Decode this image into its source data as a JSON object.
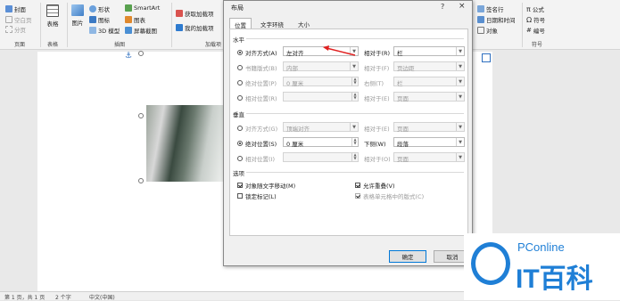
{
  "ribbon": {
    "left_items": [
      "封面",
      "空白页",
      "分页"
    ],
    "table_label": "表格",
    "illustrations": {
      "picture": "图片",
      "shapes": "形状",
      "icons": "图标",
      "model3d": "3D 模型",
      "smartart": "SmartArt",
      "chart": "图表",
      "screenshot": "屏幕截图"
    },
    "addins": {
      "get": "获取加载项",
      "my": "我的加载项"
    },
    "right_items": {
      "signature": "签名行",
      "datetime": "日期和时间",
      "object": "对象",
      "equation": "公式",
      "symbol": "符号",
      "number": "编号"
    },
    "group_labels": {
      "pages": "页面",
      "tables": "表格",
      "illustrations": "插图",
      "addins": "加载项",
      "symbols": "符号"
    }
  },
  "dialog": {
    "title": "布局",
    "help": "?",
    "close": "×",
    "tabs": [
      "位置",
      "文字环绕",
      "大小"
    ],
    "horizontal": {
      "heading": "水平",
      "rows": [
        {
          "label": "对齐方式(A)",
          "value": "左对齐",
          "rel_label": "相对于(R)",
          "rel_value": "栏",
          "enabled": true,
          "selected": true
        },
        {
          "label": "书籍版式(B)",
          "value": "内部",
          "rel_label": "相对于(F)",
          "rel_value": "页边距",
          "enabled": false,
          "selected": false
        },
        {
          "label": "绝对位置(P)",
          "value": "0 厘米",
          "rel_label": "右侧(T)",
          "rel_value": "栏",
          "enabled": false,
          "selected": false
        },
        {
          "label": "相对位置(R)",
          "value": "",
          "rel_label": "相对于(E)",
          "rel_value": "页面",
          "enabled": false,
          "selected": false
        }
      ]
    },
    "vertical": {
      "heading": "垂直",
      "rows": [
        {
          "label": "对齐方式(G)",
          "value": "顶端对齐",
          "rel_label": "相对于(E)",
          "rel_value": "页面",
          "enabled": false,
          "selected": false
        },
        {
          "label": "绝对位置(S)",
          "value": "0 厘米",
          "rel_label": "下侧(W)",
          "rel_value": "段落",
          "enabled": true,
          "selected": true
        },
        {
          "label": "相对位置(I)",
          "value": "",
          "rel_label": "相对于(O)",
          "rel_value": "页面",
          "enabled": false,
          "selected": false
        }
      ]
    },
    "options": {
      "heading": "选项",
      "move_with_text": "对象随文字移动(M)",
      "lock_anchor": "锁定标记(L)",
      "allow_overlap": "允许重叠(V)",
      "table_layout": "表格单元格中的版式(C)"
    },
    "ok": "确定",
    "cancel": "取消"
  },
  "status": {
    "page": "第 1 页，共 1 页",
    "words": "2 个字",
    "lang": "中文(中国)"
  },
  "watermark": {
    "brand": "PConline",
    "name": "IT百科"
  },
  "colors": {
    "accent": "#0078d7",
    "arrow": "#e02020",
    "logo_blue": "#1f7fd6"
  }
}
